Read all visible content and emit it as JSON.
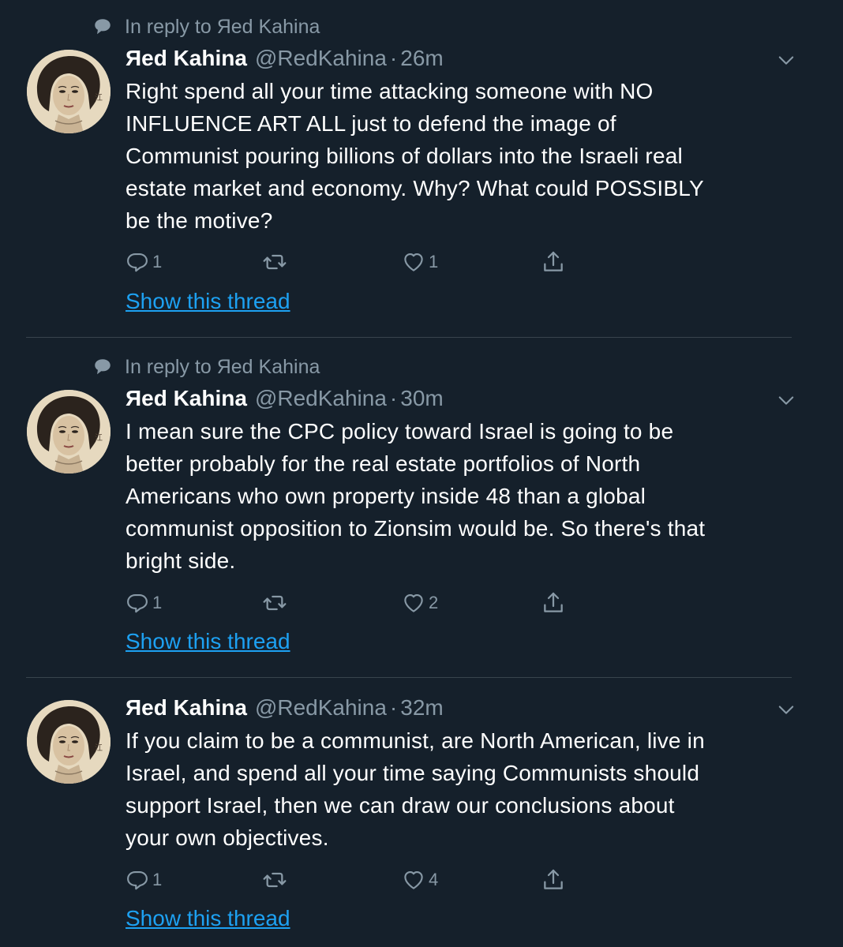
{
  "tweets": [
    {
      "reply_context": "In reply to Яed Kahina",
      "name": "Яed Kahina",
      "handle": "@RedKahina",
      "separator": "·",
      "time": "26m",
      "body_lines": [
        "Right spend all your time attacking someone with NO",
        "INFLUENCE ART ALL just to defend the image of",
        "Communist pouring billions of dollars  into the Israeli real",
        "estate market and economy. Why? What could POSSIBLY",
        "be the motive?"
      ],
      "replies": "1",
      "retweets": "",
      "likes": "1",
      "show_thread": "Show this thread"
    },
    {
      "reply_context": "In reply to Яed Kahina",
      "name": "Яed Kahina",
      "handle": "@RedKahina",
      "separator": "·",
      "time": "30m",
      "body_lines": [
        "I mean sure the CPC policy toward Israel is going to be",
        "better probably for the real estate portfolios of North",
        "Americans who own property inside 48 than a global",
        "communist opposition to Zionsim would be. So there's that",
        "bright side."
      ],
      "replies": "1",
      "retweets": "",
      "likes": "2",
      "show_thread": "Show this thread"
    },
    {
      "reply_context": "",
      "name": "Яed Kahina",
      "handle": "@RedKahina",
      "separator": "·",
      "time": "32m",
      "body_lines": [
        "If you claim to be a communist, are North American, live in",
        "Israel, and spend all your time saying Communists should",
        "support Israel,  then we can draw our conclusions about",
        "your own objectives."
      ],
      "replies": "1",
      "retweets": "",
      "likes": "4",
      "show_thread": "Show this thread"
    }
  ],
  "avatar_seal_text": "江",
  "colors": {
    "background": "#15202b",
    "text": "#ffffff",
    "muted": "#8899a6",
    "link": "#1da1f2",
    "divider": "#38444d"
  },
  "icons": [
    "reply-bubble-icon",
    "comment-icon",
    "retweet-icon",
    "heart-icon",
    "share-icon",
    "chevron-down-icon"
  ]
}
